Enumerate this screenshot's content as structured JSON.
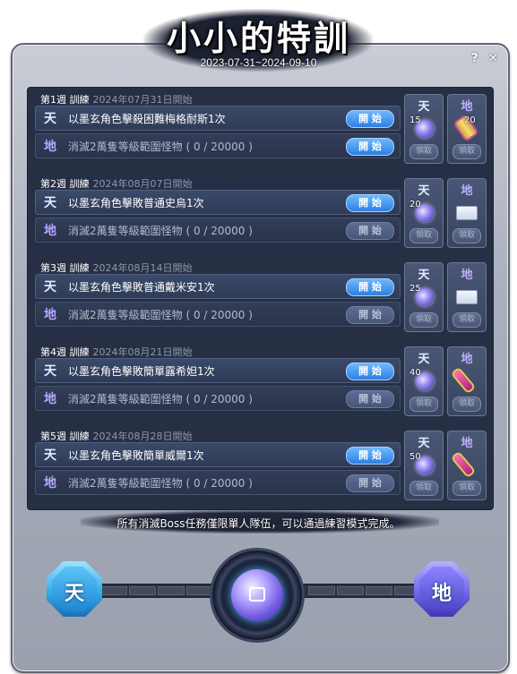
{
  "header": {
    "title": "小小的特訓",
    "dates": "2023-07-31~2024-09-10",
    "help_label": "?",
    "close_label": "✕"
  },
  "weeks": [
    {
      "label": "第1週 訓練",
      "start": "2024年07月31日開始",
      "heaven_tag": "天",
      "heaven_task": "以墨玄角色擊殺困難梅格耐斯1次",
      "heaven_button": "開 始",
      "earth_tag": "地",
      "earth_task": "消滅2萬隻等級範圍怪物 ( 0 / 20000 )",
      "earth_button": "開 始",
      "reward_heaven_label": "天",
      "reward_heaven_count": "15",
      "reward_earth_label": "地",
      "reward_earth_count": "20",
      "claim_label": "領取",
      "earth_icon": "scroll-icon"
    },
    {
      "label": "第2週 訓練",
      "start": "2024年08月07日開始",
      "heaven_tag": "天",
      "heaven_task": "以墨玄角色擊敗普通史烏1次",
      "heaven_button": "開 始",
      "earth_tag": "地",
      "earth_task": "消滅2萬隻等級範圍怪物 ( 0 / 20000 )",
      "earth_button": "開 始",
      "reward_heaven_label": "天",
      "reward_heaven_count": "20",
      "reward_earth_label": "地",
      "reward_earth_count": "",
      "claim_label": "領取",
      "earth_icon": "ticket-icon"
    },
    {
      "label": "第3週 訓練",
      "start": "2024年08月14日開始",
      "heaven_tag": "天",
      "heaven_task": "以墨玄角色擊敗普通戴米安1次",
      "heaven_button": "開 始",
      "earth_tag": "地",
      "earth_task": "消滅2萬隻等級範圍怪物 ( 0 / 20000 )",
      "earth_button": "開 始",
      "reward_heaven_label": "天",
      "reward_heaven_count": "25",
      "reward_earth_label": "地",
      "reward_earth_count": "",
      "claim_label": "領取",
      "earth_icon": "ticket-icon"
    },
    {
      "label": "第4週 訓練",
      "start": "2024年08月21日開始",
      "heaven_tag": "天",
      "heaven_task": "以墨玄角色擊敗簡單露希妲1次",
      "heaven_button": "開 始",
      "earth_tag": "地",
      "earth_task": "消滅2萬隻等級範圍怪物 ( 0 / 20000 )",
      "earth_button": "開 始",
      "reward_heaven_label": "天",
      "reward_heaven_count": "40",
      "reward_earth_label": "地",
      "reward_earth_count": "",
      "claim_label": "領取",
      "earth_icon": "wand-icon"
    },
    {
      "label": "第5週 訓練",
      "start": "2024年08月28日開始",
      "heaven_tag": "天",
      "heaven_task": "以墨玄角色擊敗簡單威爾1次",
      "heaven_button": "開 始",
      "earth_tag": "地",
      "earth_task": "消滅2萬隻等級範圍怪物 ( 0 / 20000 )",
      "earth_button": "開 始",
      "reward_heaven_label": "天",
      "reward_heaven_count": "50",
      "reward_earth_label": "地",
      "reward_earth_count": "",
      "claim_label": "領取",
      "earth_icon": "wand-icon"
    }
  ],
  "notice": "所有消滅Boss任務僅限單人隊伍，可以通過練習模式完成。",
  "bottom": {
    "heaven_badge": "天",
    "earth_badge": "地",
    "center_icon": "chest-icon"
  },
  "colors": {
    "start_button": "#2d7fe3",
    "disabled_button": "#485676",
    "panel": "#262f44"
  }
}
